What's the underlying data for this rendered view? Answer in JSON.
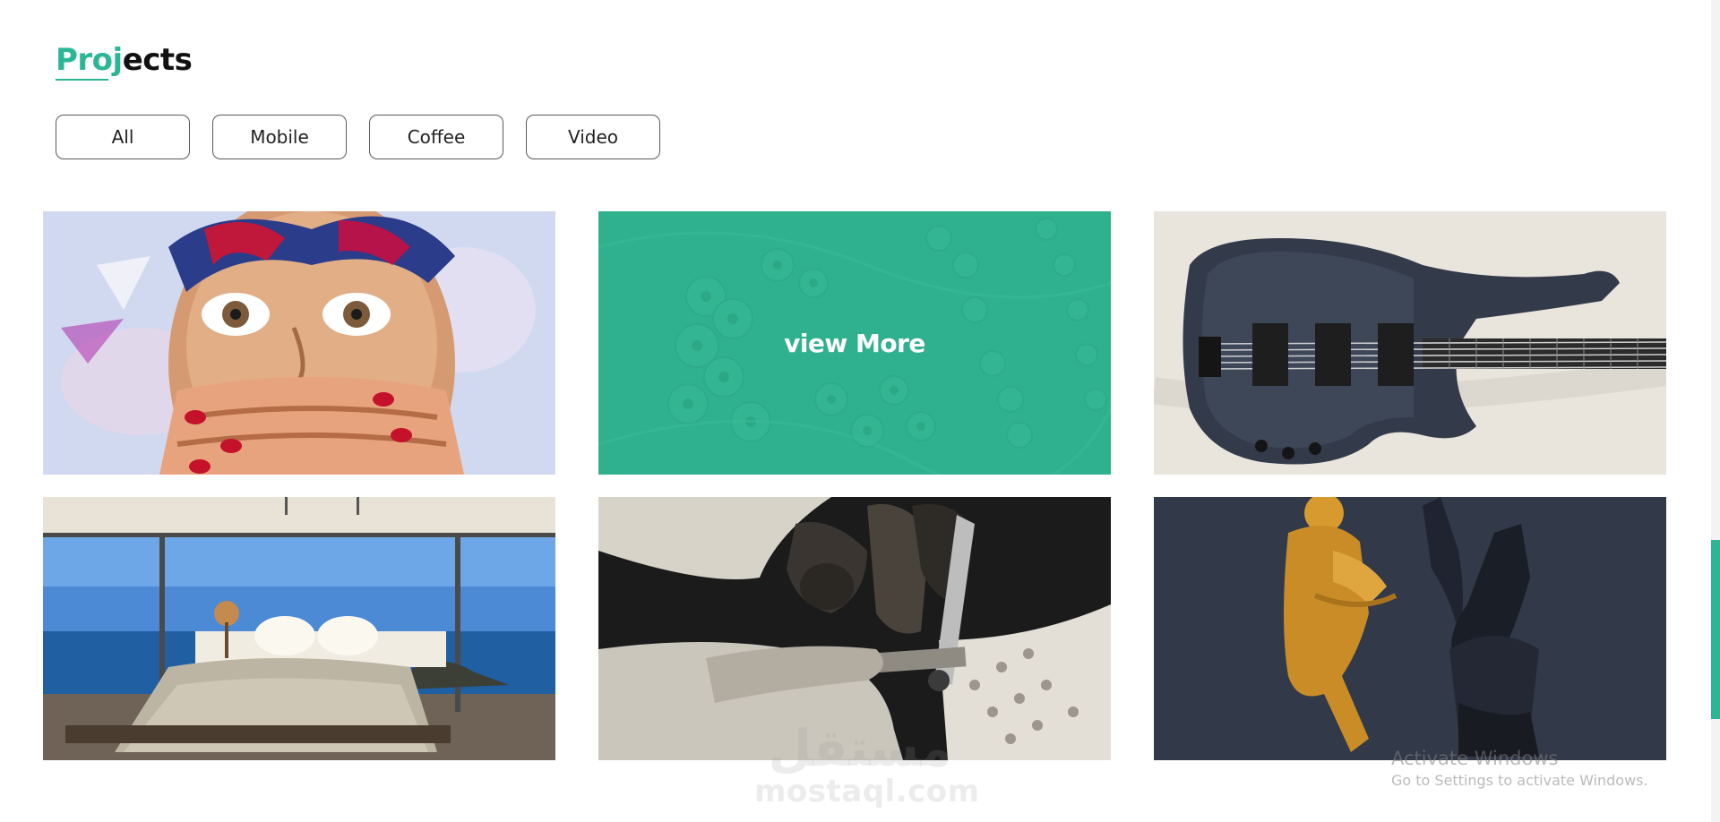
{
  "section": {
    "title_accent": "Proj",
    "title_rest": "ects"
  },
  "filters": [
    {
      "label": "All"
    },
    {
      "label": "Mobile"
    },
    {
      "label": "Coffee"
    },
    {
      "label": "Video"
    }
  ],
  "projects": [
    {
      "image": "painted-face-portrait"
    },
    {
      "image": "teal-abstract-pattern",
      "overlay_label": "view More"
    },
    {
      "image": "bass-guitar"
    },
    {
      "image": "ocean-view-bedroom"
    },
    {
      "image": "hands-with-tool-bw"
    },
    {
      "image": "3d-figures"
    }
  ],
  "watermarks": {
    "logo_glyph": "مستقل",
    "logo_text": "mostaql.com",
    "activate_title": "Activate Windows",
    "activate_sub": "Go to Settings to activate Windows."
  },
  "colors": {
    "accent": "#2bb795",
    "overlay": "#30b290"
  }
}
